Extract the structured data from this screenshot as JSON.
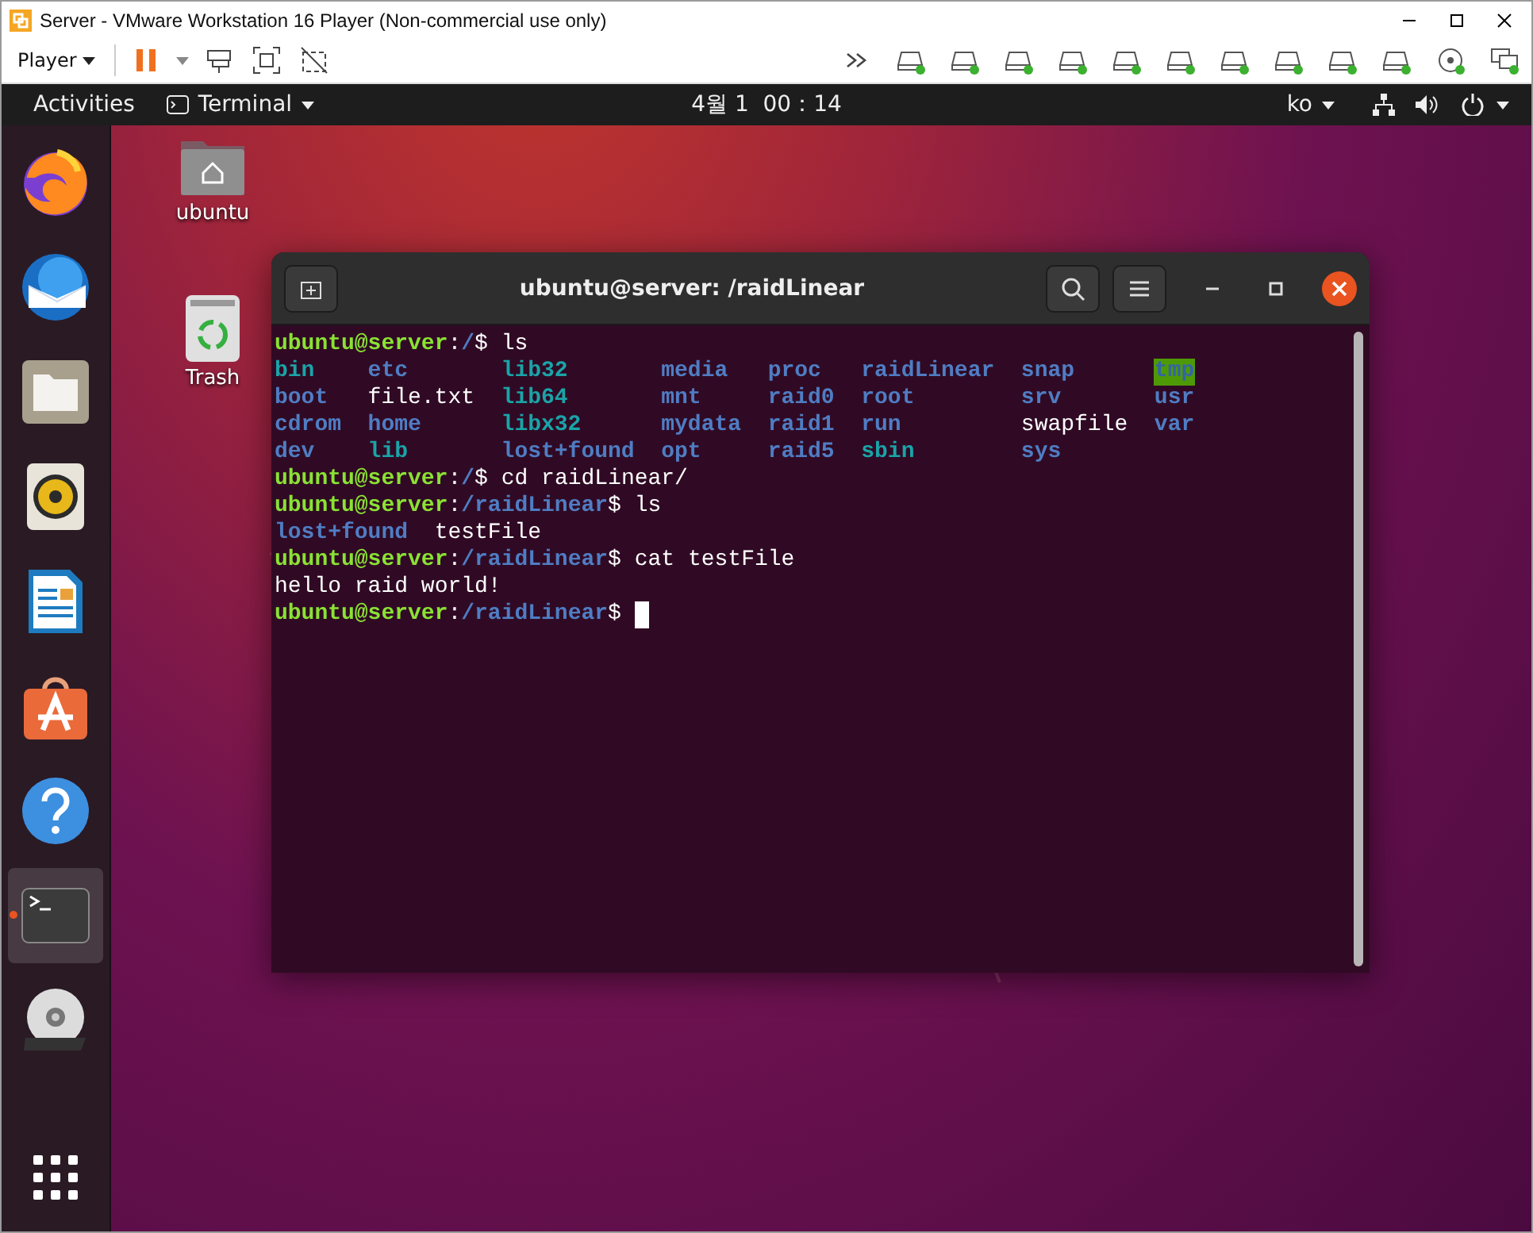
{
  "vm_window": {
    "title": "Server - VMware Workstation 16 Player (Non-commercial use only)",
    "player_menu": "Player",
    "devices": [
      {
        "kind": "forward"
      },
      {
        "kind": "drive",
        "connected": true
      },
      {
        "kind": "drive",
        "connected": true
      },
      {
        "kind": "drive",
        "connected": true
      },
      {
        "kind": "drive",
        "connected": true
      },
      {
        "kind": "drive",
        "connected": true
      },
      {
        "kind": "drive",
        "connected": true
      },
      {
        "kind": "drive",
        "connected": true
      },
      {
        "kind": "drive",
        "connected": true
      },
      {
        "kind": "drive",
        "connected": true
      },
      {
        "kind": "drive",
        "connected": true
      },
      {
        "kind": "audio",
        "connected": true
      },
      {
        "kind": "display",
        "connected": true
      }
    ]
  },
  "top_bar": {
    "activities": "Activities",
    "app_menu": "Terminal",
    "clock": "4월 1  00：14",
    "input_source": "ko"
  },
  "dock": [
    {
      "kind": "browser",
      "running": false,
      "selected": false
    },
    {
      "kind": "mail",
      "running": false,
      "selected": false
    },
    {
      "kind": "files",
      "running": false,
      "selected": false
    },
    {
      "kind": "music",
      "running": false,
      "selected": false
    },
    {
      "kind": "writer",
      "running": false,
      "selected": false
    },
    {
      "kind": "store",
      "running": false,
      "selected": false
    },
    {
      "kind": "help",
      "running": false,
      "selected": false
    },
    {
      "kind": "terminal",
      "running": true,
      "selected": true
    },
    {
      "kind": "disc",
      "running": false,
      "selected": false
    }
  ],
  "desktop_icons": [
    {
      "kind": "home",
      "label": "ubuntu"
    },
    {
      "kind": "trash",
      "label": "Trash"
    }
  ],
  "terminal": {
    "title": "ubuntu@server: /raidLinear",
    "lines": [
      {
        "kind": "prompt",
        "user": "ubuntu@server",
        "sep": ":",
        "path": "/",
        "symbol": "$",
        "command": "ls"
      },
      {
        "kind": "columns",
        "entries": [
          {
            "name": "bin",
            "kind": "link"
          },
          {
            "name": "etc",
            "kind": "dir"
          },
          {
            "name": "lib32",
            "kind": "link"
          },
          {
            "name": "media",
            "kind": "dir"
          },
          {
            "name": "proc",
            "kind": "dir"
          },
          {
            "name": "raidLinear",
            "kind": "dir"
          },
          {
            "name": "snap",
            "kind": "dir"
          },
          {
            "name": "tmp",
            "kind": "sticky"
          }
        ]
      },
      {
        "kind": "columns",
        "entries": [
          {
            "name": "boot",
            "kind": "dir"
          },
          {
            "name": "file.txt",
            "kind": "file"
          },
          {
            "name": "lib64",
            "kind": "link"
          },
          {
            "name": "mnt",
            "kind": "dir"
          },
          {
            "name": "raid0",
            "kind": "dir"
          },
          {
            "name": "root",
            "kind": "dir"
          },
          {
            "name": "srv",
            "kind": "dir"
          },
          {
            "name": "usr",
            "kind": "dir"
          }
        ]
      },
      {
        "kind": "columns",
        "entries": [
          {
            "name": "cdrom",
            "kind": "dir"
          },
          {
            "name": "home",
            "kind": "dir"
          },
          {
            "name": "libx32",
            "kind": "link"
          },
          {
            "name": "mydata",
            "kind": "dir"
          },
          {
            "name": "raid1",
            "kind": "dir"
          },
          {
            "name": "run",
            "kind": "dir"
          },
          {
            "name": "swapfile",
            "kind": "file"
          },
          {
            "name": "var",
            "kind": "dir"
          }
        ]
      },
      {
        "kind": "columns",
        "entries": [
          {
            "name": "dev",
            "kind": "dir"
          },
          {
            "name": "lib",
            "kind": "link"
          },
          {
            "name": "lost+found",
            "kind": "dir"
          },
          {
            "name": "opt",
            "kind": "dir"
          },
          {
            "name": "raid5",
            "kind": "dir"
          },
          {
            "name": "sbin",
            "kind": "link"
          },
          {
            "name": "sys",
            "kind": "dir"
          }
        ]
      },
      {
        "kind": "prompt",
        "user": "ubuntu@server",
        "sep": ":",
        "path": "/",
        "symbol": "$",
        "command": "cd raidLinear/"
      },
      {
        "kind": "prompt",
        "user": "ubuntu@server",
        "sep": ":",
        "path": "/raidLinear",
        "symbol": "$",
        "command": "ls"
      },
      {
        "kind": "inline",
        "entries": [
          {
            "name": "lost+found",
            "kind": "dir"
          },
          {
            "name": "testFile",
            "kind": "file"
          }
        ]
      },
      {
        "kind": "prompt",
        "user": "ubuntu@server",
        "sep": ":",
        "path": "/raidLinear",
        "symbol": "$",
        "command": "cat testFile"
      },
      {
        "kind": "output",
        "text": "hello raid world!"
      },
      {
        "kind": "prompt",
        "user": "ubuntu@server",
        "sep": ":",
        "path": "/raidLinear",
        "symbol": "$",
        "cursor": true
      }
    ]
  }
}
